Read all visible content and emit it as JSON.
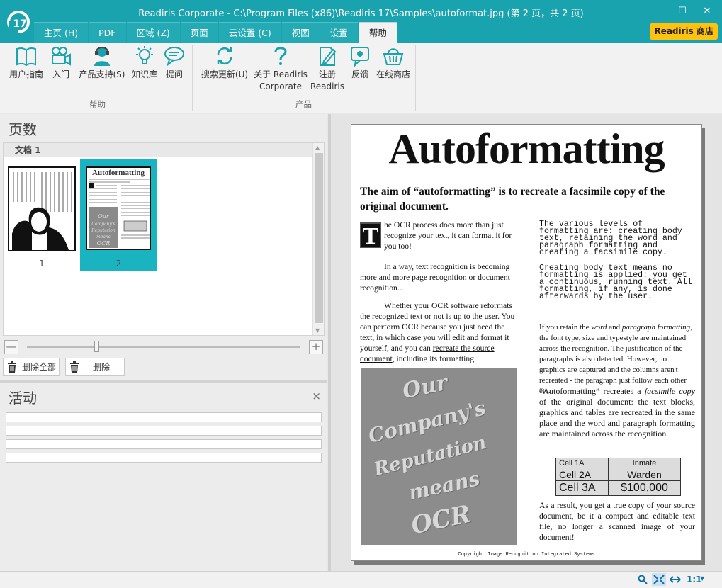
{
  "window": {
    "title": "Readiris Corporate - C:\\Program Files (x86)\\Readiris 17\\Samples\\autoformat.jpg (第 2 页，共 2 页)",
    "logo_text": "17",
    "accent_color": "#19a3ae"
  },
  "tabs": [
    {
      "label": "主页 (H)"
    },
    {
      "label": "PDF"
    },
    {
      "label": "区域 (Z)"
    },
    {
      "label": "页面"
    },
    {
      "label": "云设置 (C)"
    },
    {
      "label": "视图"
    },
    {
      "label": "设置"
    },
    {
      "label": "帮助"
    }
  ],
  "store_button": "Readiris 商店",
  "ribbon": {
    "help_group": {
      "label": "帮助",
      "items": [
        {
          "label": "用户指南",
          "icon": "book-icon"
        },
        {
          "label": "入门",
          "icon": "video-camera-icon"
        },
        {
          "label": "产品支持(S)",
          "icon": "support-person-icon"
        },
        {
          "label": "知识库",
          "icon": "lightbulb-icon"
        },
        {
          "label": "提问",
          "icon": "speech-bubble-icon"
        }
      ]
    },
    "product_group": {
      "label": "产品",
      "items": [
        {
          "label": "搜索更新(U)",
          "icon": "refresh-icon"
        },
        {
          "label": "关于 Readiris",
          "label2": "Corporate",
          "icon": "question-icon"
        },
        {
          "label": "注册",
          "label2": "Readiris",
          "icon": "register-icon"
        },
        {
          "label": "反馈",
          "icon": "feedback-icon"
        },
        {
          "label": "在线商店",
          "icon": "basket-icon"
        }
      ]
    }
  },
  "pages_panel": {
    "title": "页数",
    "document_label": "文档 1",
    "pages": [
      {
        "label": "1"
      },
      {
        "label": "2",
        "selected": true
      }
    ],
    "thumb2_title": "Autoformatting",
    "delete_all": "删除全部",
    "delete": "删除",
    "zoom_out": "—",
    "zoom_in": "+"
  },
  "activity_panel": {
    "title": "活动",
    "close": "×"
  },
  "document": {
    "title": "Autoformatting",
    "subtitle": "The aim of “autoformatting” is to recreate a facsimile copy of the original document.",
    "dropcap": "T",
    "para1_a": "he OCR process does more than just recognize your text, ",
    "para1_u": "it can format it",
    "para1_b": " for you too!",
    "para2": "In a way, text recognition is becoming more and more page recognition or document recognition...",
    "para3_a": "Whether your OCR software reformats the recognized text or not is up to the user. You can perform OCR because you just need the text, in which case you will edit and format it yourself, and you can ",
    "para3_u": "recreate the source document",
    "para3_b": ", including its formatting.",
    "image_lines": [
      "Our",
      "Company's",
      "Reputation",
      "means",
      "OCR"
    ],
    "mono1": "The various levels of formatting are: creating body text, retaining the word and paragraph formatting and creating a facsimile copy.",
    "mono2": "Creating body text means no formatting is applied: you get a continuous, running text. All formatting, if any, is done afterwards by the user.",
    "para4_a": "If you retain the ",
    "para4_i1": "word",
    "para4_b": " and ",
    "para4_i2": "paragraph formatting",
    "para4_c": ", the font type, size and typestyle are maintained across the recognition. The justification of the paragraphs is also detected. However, no graphics are captured and the columns aren't recreated - the paragraph just follow each other etc.",
    "para5_a": "“Autoformatting” recreates a ",
    "para5_i": "facsimile copy",
    "para5_b": " of the original document: the text blocks, graphics and tables are recreated in the same place and the word and paragraph formatting are maintained across the recognition.",
    "table": [
      [
        "Cell 1A",
        "Inmate"
      ],
      [
        "Cell 2A",
        "Warden"
      ],
      [
        "Cell 3A",
        "$100,000"
      ]
    ],
    "para6": "As a result, you get a true copy of your source document, be it a compact and editable text file, no longer a scanned image of your document!",
    "copyright": "Copyright Image Recognition Integrated Systems"
  },
  "statusbar": {
    "zoom_label": "1:1"
  }
}
